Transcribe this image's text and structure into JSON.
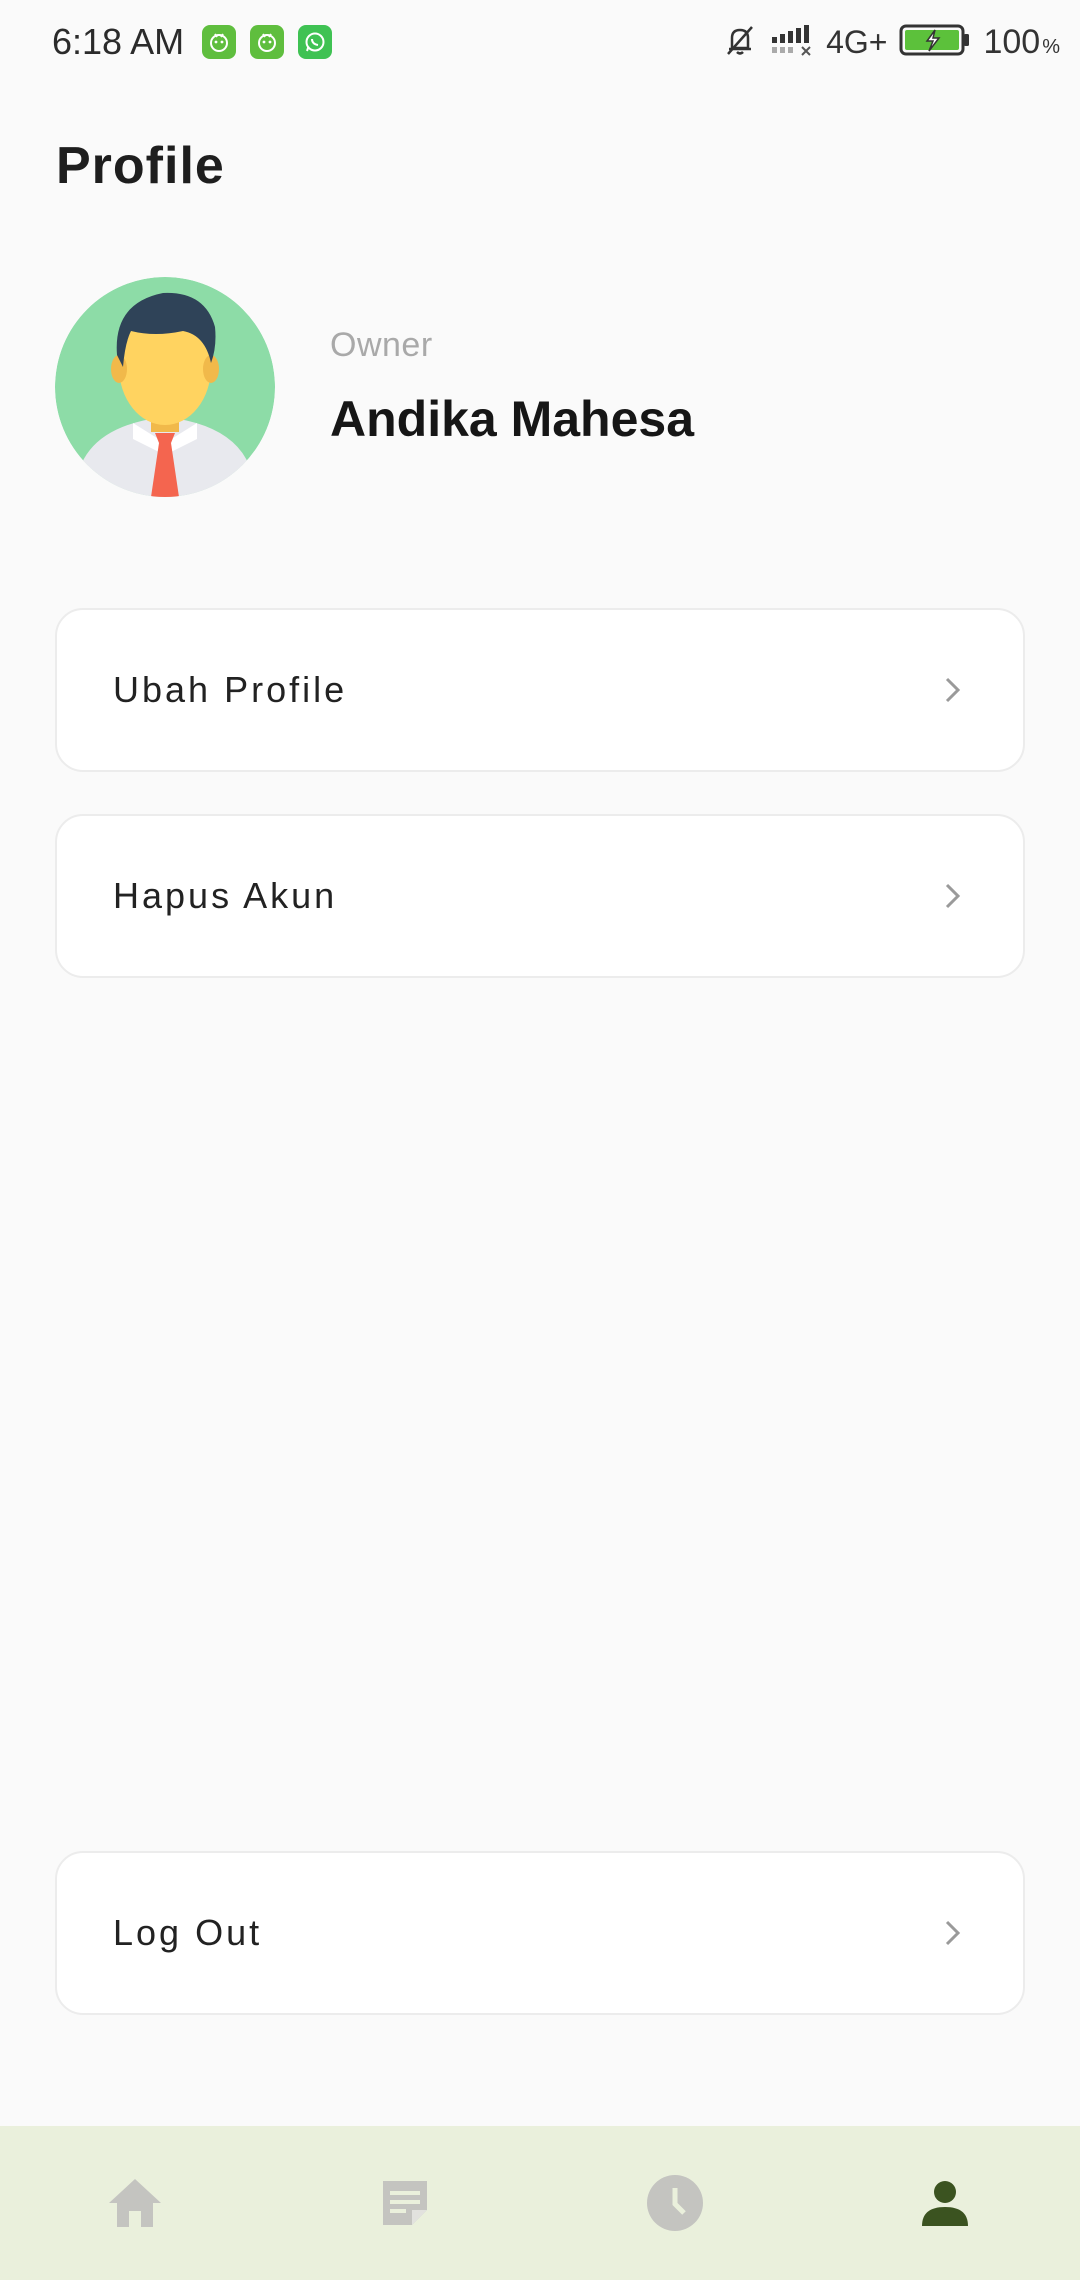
{
  "status_bar": {
    "time": "6:18 AM",
    "network": "4G+",
    "battery_percent": "100",
    "percent_sign": "%",
    "notification_icons": [
      "app-icon",
      "app-icon",
      "whatsapp-icon"
    ]
  },
  "page": {
    "title": "Profile"
  },
  "profile": {
    "role": "Owner",
    "name": "Andika Mahesa"
  },
  "menu": {
    "edit_profile": "Ubah Profile",
    "delete_account": "Hapus Akun",
    "logout": "Log Out"
  },
  "bottom_nav": {
    "items": [
      "home-icon",
      "note-icon",
      "clock-icon",
      "person-icon"
    ],
    "active_index": 3
  },
  "colors": {
    "background": "#fafafa",
    "nav_background": "#eaf0dc",
    "nav_active": "#3b5320",
    "nav_inactive": "#c4c4c0",
    "avatar_bg": "#8ddca7",
    "chevron": "#9a9a9a"
  }
}
